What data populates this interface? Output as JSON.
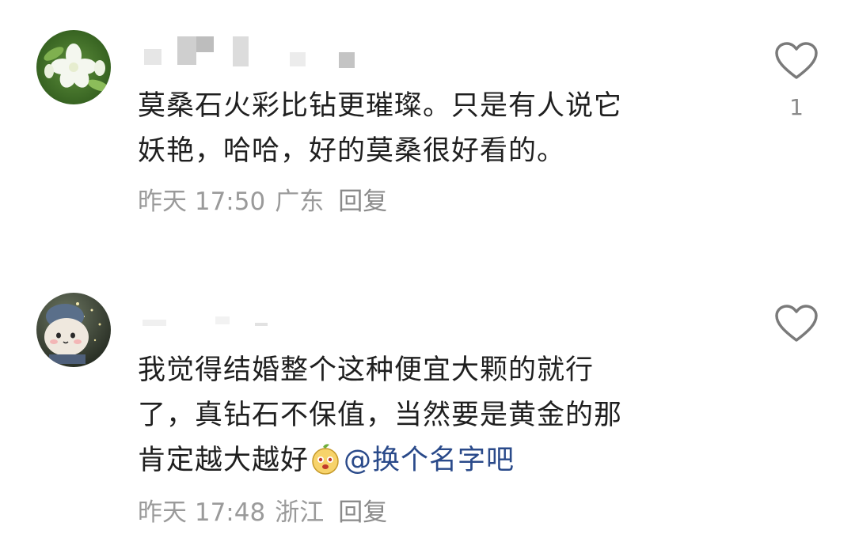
{
  "comments": [
    {
      "text_line1": "莫桑石火彩比钻更璀璨。只是有人说它",
      "text_line2": "妖艳，哈哈，好的莫桑很好看的。",
      "time": "昨天 17:50",
      "location": "广东",
      "reply_label": "回复",
      "like_count": "1",
      "avatar_icon": "jasmine-flower-icon",
      "like_icon": "heart-outline-icon"
    },
    {
      "text_line1": "我觉得结婚整个这种便宜大颗的就行",
      "text_line2": "了，真钻石不保值，当然要是黄金的那",
      "text_line3_prefix": "肯定越大越好",
      "mention": "@换个名字吧",
      "time": "昨天 17:48",
      "location": "浙江",
      "reply_label": "回复",
      "avatar_icon": "plush-toy-avatar-icon",
      "emoji_icon": "peach-face-emoji-icon",
      "like_icon": "heart-outline-icon"
    }
  ],
  "colors": {
    "text": "#1f1f1f",
    "meta": "#9a9a9a",
    "mention": "#2a4a8a",
    "heart": "#7a7a7a"
  }
}
